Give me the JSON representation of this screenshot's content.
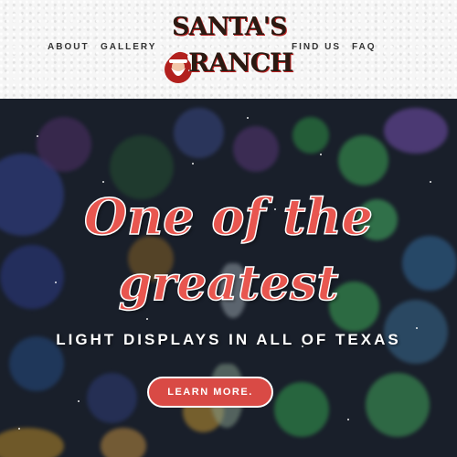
{
  "nav": {
    "left": [
      "ABOUT",
      "GALLERY"
    ],
    "right": [
      "FIND US",
      "FAQ"
    ]
  },
  "logo": {
    "line1": "SANTA'S",
    "line2": "RANCH"
  },
  "hero": {
    "headline_line1": "One of the",
    "headline_line2": "greatest",
    "subheadline": "LIGHT DISPLAYS IN ALL OF TEXAS",
    "cta_label": "LEARN MORE."
  },
  "colors": {
    "accent": "#d94a45",
    "header_bg": "#f6f6f6",
    "nav_text": "#333333"
  }
}
